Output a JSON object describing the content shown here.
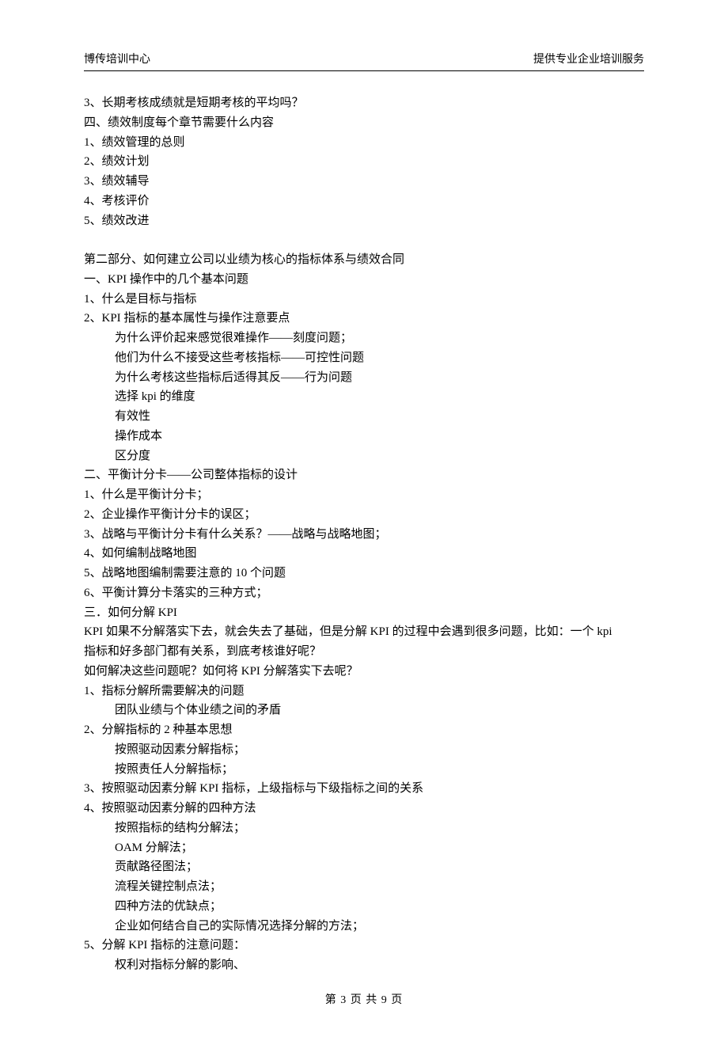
{
  "header": {
    "left": "博传培训中心",
    "right": "提供专业企业培训服务"
  },
  "lines": [
    {
      "t": "3、长期考核成绩就是短期考核的平均吗？"
    },
    {
      "t": "四、绩效制度每个章节需要什么内容"
    },
    {
      "t": "1、绩效管理的总则"
    },
    {
      "t": "2、绩效计划"
    },
    {
      "t": "3、绩效辅导"
    },
    {
      "t": "4、考核评价"
    },
    {
      "t": "5、绩效改进"
    },
    {
      "blank": true
    },
    {
      "t": "第二部分、如何建立公司以业绩为核心的指标体系与绩效合同"
    },
    {
      "t": "一、KPI 操作中的几个基本问题"
    },
    {
      "t": "1、什么是目标与指标"
    },
    {
      "t": "2、KPI 指标的基本属性与操作注意要点"
    },
    {
      "t": "为什么评价起来感觉很难操作——刻度问题；",
      "indent": 1
    },
    {
      "t": "他们为什么不接受这些考核指标——可控性问题",
      "indent": 1
    },
    {
      "t": "为什么考核这些指标后适得其反——行为问题",
      "indent": 1
    },
    {
      "t": "选择 kpi 的维度",
      "indent": 1
    },
    {
      "t": "有效性",
      "indent": 1
    },
    {
      "t": "操作成本",
      "indent": 1
    },
    {
      "t": "区分度",
      "indent": 1
    },
    {
      "t": "二、平衡计分卡——公司整体指标的设计"
    },
    {
      "t": "1、什么是平衡计分卡；"
    },
    {
      "t": "2、企业操作平衡计分卡的误区；"
    },
    {
      "t": "3、战略与平衡计分卡有什么关系？——战略与战略地图；"
    },
    {
      "t": "4、如何编制战略地图"
    },
    {
      "t": "5、战略地图编制需要注意的 10 个问题"
    },
    {
      "t": "6、平衡计算分卡落实的三种方式；"
    },
    {
      "t": "三．如何分解 KPI"
    },
    {
      "t": "KPI 如果不分解落实下去，就会失去了基础，但是分解 KPI 的过程中会遇到很多问题，比如：一个 kpi"
    },
    {
      "t": "指标和好多部门都有关系，到底考核谁好呢？"
    },
    {
      "t": "如何解决这些问题呢？如何将 KPI 分解落实下去呢？"
    },
    {
      "t": "1、指标分解所需要解决的问题"
    },
    {
      "t": "团队业绩与个体业绩之间的矛盾",
      "indent": 1
    },
    {
      "t": "2、分解指标的 2 种基本思想"
    },
    {
      "t": "按照驱动因素分解指标；",
      "indent": 1
    },
    {
      "t": "按照责任人分解指标；",
      "indent": 1
    },
    {
      "t": "3、按照驱动因素分解 KPI 指标，上级指标与下级指标之间的关系"
    },
    {
      "t": "4、按照驱动因素分解的四种方法"
    },
    {
      "t": "按照指标的结构分解法；",
      "indent": 1
    },
    {
      "t": "OAM 分解法；",
      "indent": 1
    },
    {
      "t": "贡献路径图法；",
      "indent": 1
    },
    {
      "t": "流程关键控制点法；",
      "indent": 1
    },
    {
      "t": "四种方法的优缺点；",
      "indent": 1
    },
    {
      "t": "企业如何结合自己的实际情况选择分解的方法；",
      "indent": 1
    },
    {
      "t": "5、分解 KPI 指标的注意问题："
    },
    {
      "t": "权利对指标分解的影响、",
      "indent": 1
    }
  ],
  "footer": {
    "text": "第 3 页 共 9 页"
  }
}
